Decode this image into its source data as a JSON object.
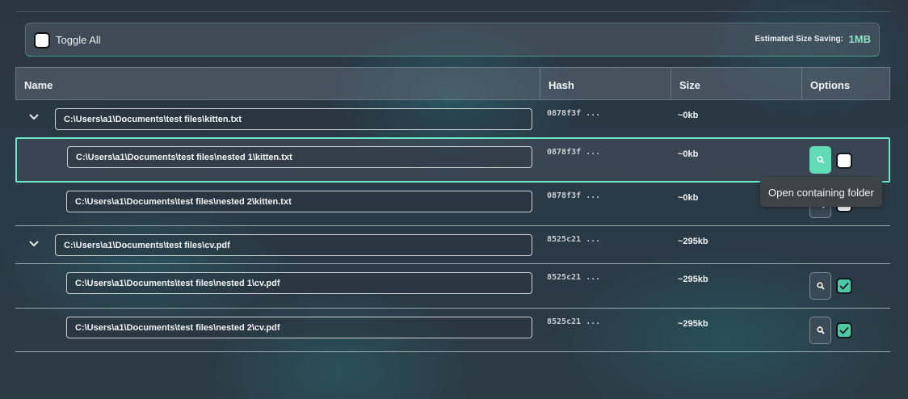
{
  "toolbar": {
    "toggle_all_label": "Toggle All",
    "saving_label": "Estimated Size Saving:",
    "saving_value": "1MB"
  },
  "table": {
    "headers": {
      "name": "Name",
      "hash": "Hash",
      "size": "Size",
      "options": "Options"
    },
    "groups": [
      {
        "path": "C:\\Users\\a1\\Documents\\test files\\kitten.txt",
        "hash": "0878f3f ...",
        "size": "~0kb",
        "children": [
          {
            "path": "C:\\Users\\a1\\Documents\\test files\\nested 1\\kitten.txt",
            "hash": "0878f3f ...",
            "size": "~0kb",
            "checked": false
          },
          {
            "path": "C:\\Users\\a1\\Documents\\test files\\nested 2\\kitten.txt",
            "hash": "0878f3f ...",
            "size": "~0kb",
            "checked": false
          }
        ]
      },
      {
        "path": "C:\\Users\\a1\\Documents\\test files\\cv.pdf",
        "hash": "8525c21 ...",
        "size": "~295kb",
        "children": [
          {
            "path": "C:\\Users\\a1\\Documents\\test files\\nested 1\\cv.pdf",
            "hash": "8525c21 ...",
            "size": "~295kb",
            "checked": true
          },
          {
            "path": "C:\\Users\\a1\\Documents\\test files\\nested 2\\cv.pdf",
            "hash": "8525c21 ...",
            "size": "~295kb",
            "checked": true
          }
        ]
      }
    ]
  },
  "tooltip": {
    "text": "Open containing folder"
  },
  "icons": {
    "expand": "chevron-down-icon",
    "open_folder": "search-icon",
    "check": "check-icon"
  },
  "colors": {
    "accent": "#62dcb4",
    "checked": "#4cc8a8",
    "selected_border": "#6ee7c6"
  }
}
